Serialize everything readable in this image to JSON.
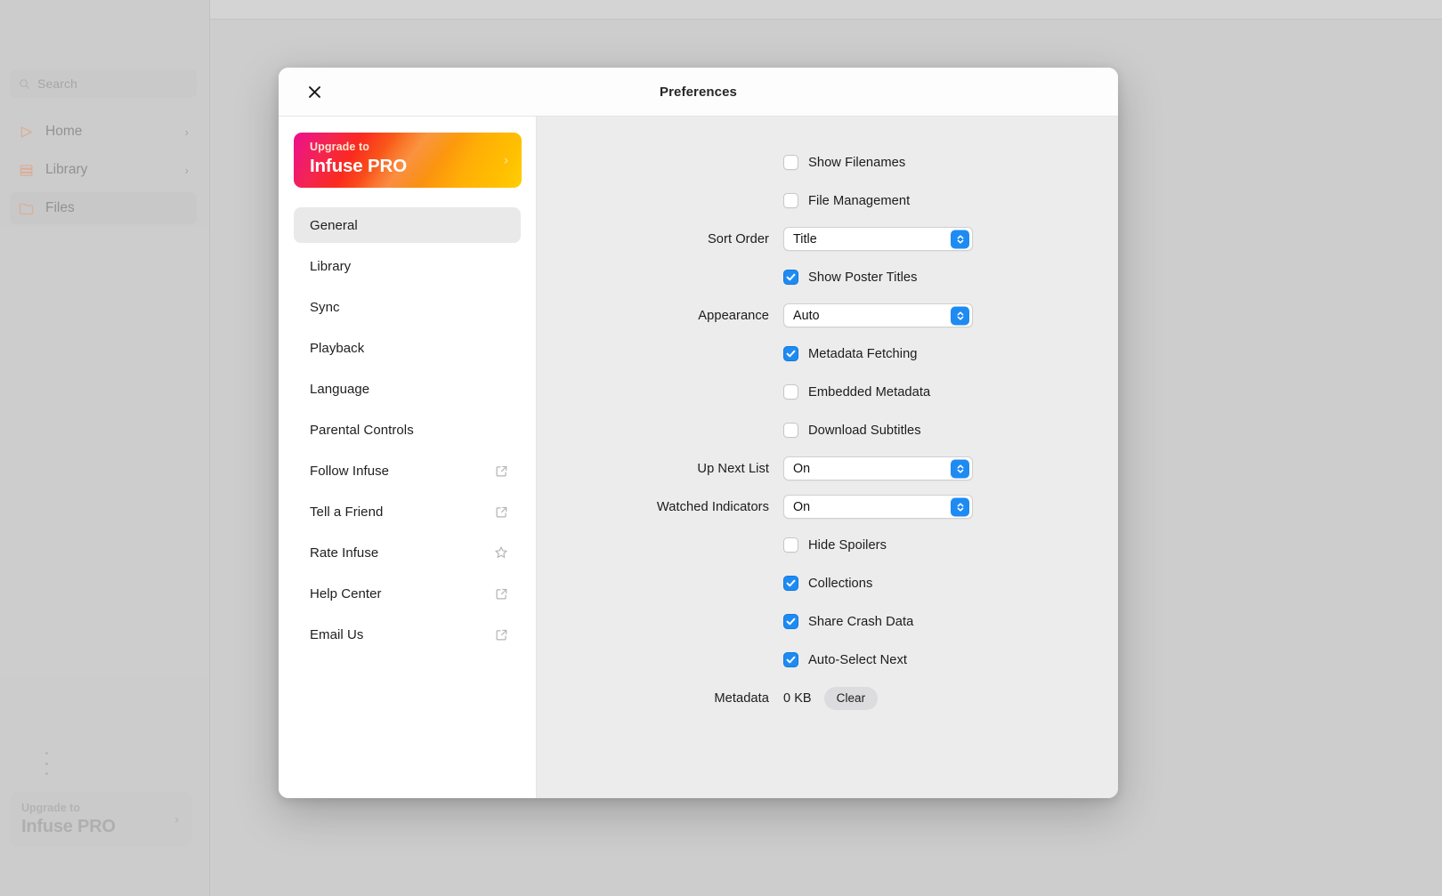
{
  "background": {
    "search": {
      "placeholder": "Search",
      "icon": "search-icon"
    },
    "nav_items": [
      {
        "label": "Home",
        "icon": "play-outline-icon",
        "chevron": "›",
        "selected": false
      },
      {
        "label": "Library",
        "icon": "library-stack-icon",
        "chevron": "›",
        "selected": false
      },
      {
        "label": "Files",
        "icon": "folder-icon",
        "chevron": "",
        "selected": true
      }
    ],
    "upgrade": {
      "small": "Upgrade to",
      "big": "Infuse PRO",
      "chevron": "›"
    }
  },
  "modal": {
    "title": "Preferences",
    "close_icon": "close-icon",
    "upgrade_banner": {
      "small": "Upgrade to",
      "big": "Infuse PRO",
      "chevron": "›"
    },
    "nav_items": [
      {
        "label": "General",
        "icon": "",
        "active": true
      },
      {
        "label": "Library",
        "icon": "",
        "active": false
      },
      {
        "label": "Sync",
        "icon": "",
        "active": false
      },
      {
        "label": "Playback",
        "icon": "",
        "active": false
      },
      {
        "label": "Language",
        "icon": "",
        "active": false
      },
      {
        "label": "Parental Controls",
        "icon": "",
        "active": false
      },
      {
        "label": "Follow Infuse",
        "icon": "external-link-icon",
        "active": false
      },
      {
        "label": "Tell a Friend",
        "icon": "external-link-icon",
        "active": false
      },
      {
        "label": "Rate Infuse",
        "icon": "star-outline-icon",
        "active": false
      },
      {
        "label": "Help Center",
        "icon": "external-link-icon",
        "active": false
      },
      {
        "label": "Email Us",
        "icon": "external-link-icon",
        "active": false
      }
    ],
    "settings": [
      {
        "kind": "checkbox",
        "label": "",
        "text": "Show Filenames",
        "checked": false
      },
      {
        "kind": "checkbox",
        "label": "",
        "text": "File Management",
        "checked": false
      },
      {
        "kind": "select",
        "label": "Sort Order",
        "value": "Title"
      },
      {
        "kind": "checkbox",
        "label": "",
        "text": "Show Poster Titles",
        "checked": true
      },
      {
        "kind": "select",
        "label": "Appearance",
        "value": "Auto"
      },
      {
        "kind": "checkbox",
        "label": "",
        "text": "Metadata Fetching",
        "checked": true
      },
      {
        "kind": "checkbox",
        "label": "",
        "text": "Embedded Metadata",
        "checked": false
      },
      {
        "kind": "checkbox",
        "label": "",
        "text": "Download Subtitles",
        "checked": false
      },
      {
        "kind": "select",
        "label": "Up Next List",
        "value": "On"
      },
      {
        "kind": "select",
        "label": "Watched Indicators",
        "value": "On"
      },
      {
        "kind": "checkbox",
        "label": "",
        "text": "Hide Spoilers",
        "checked": false
      },
      {
        "kind": "checkbox",
        "label": "",
        "text": "Collections",
        "checked": true
      },
      {
        "kind": "checkbox",
        "label": "",
        "text": "Share Crash Data",
        "checked": true
      },
      {
        "kind": "checkbox",
        "label": "",
        "text": "Auto-Select Next",
        "checked": true
      },
      {
        "kind": "meta",
        "label": "Metadata",
        "size": "0 KB",
        "button": "Clear"
      }
    ]
  },
  "colors": {
    "accent_blue": "#1e8bf3",
    "banner_pink": "#ec0f8e",
    "banner_red": "#fa2a1f",
    "banner_orange": "#fa8c10",
    "banner_yellow": "#ffcf05",
    "panel_gray": "#ececec",
    "sidebar_icon_orange": "#f08a5a"
  }
}
